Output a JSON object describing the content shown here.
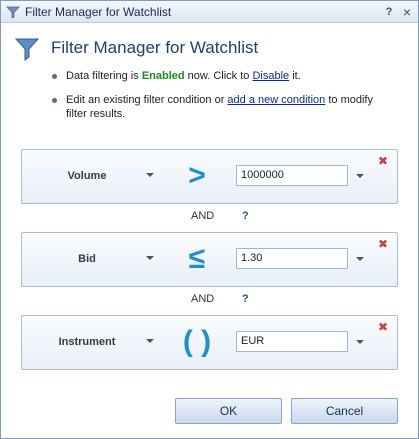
{
  "window": {
    "title": "Filter Manager for Watchlist",
    "help_glyph": "?",
    "close_glyph": "×"
  },
  "header": {
    "title": "Filter Manager for Watchlist"
  },
  "info": {
    "line1_prefix": "Data filtering is ",
    "line1_status": "Enabled",
    "line1_middle": " now. Click to ",
    "line1_link": "Disable",
    "line1_suffix": " it.",
    "line2_prefix": "Edit an existing filter condition or ",
    "line2_link": "add a new condition",
    "line2_suffix": " to modify",
    "line3": "filter results."
  },
  "conditions": [
    {
      "field": "Volume",
      "operator": ">",
      "value": "1000000"
    },
    {
      "field": "Bid",
      "operator": "≤",
      "value": "1.30"
    },
    {
      "field": "Instrument",
      "operator": "( )",
      "value": "EUR"
    }
  ],
  "logic": [
    {
      "label": "AND",
      "help": "?"
    },
    {
      "label": "AND",
      "help": "?"
    }
  ],
  "remove_glyph": "✖",
  "buttons": {
    "ok": "OK",
    "cancel": "Cancel"
  },
  "colors": {
    "accent": "#1f8fd0",
    "enabled": "#1a8a1a",
    "link": "#0b2a8f",
    "remove": "#c84040"
  }
}
